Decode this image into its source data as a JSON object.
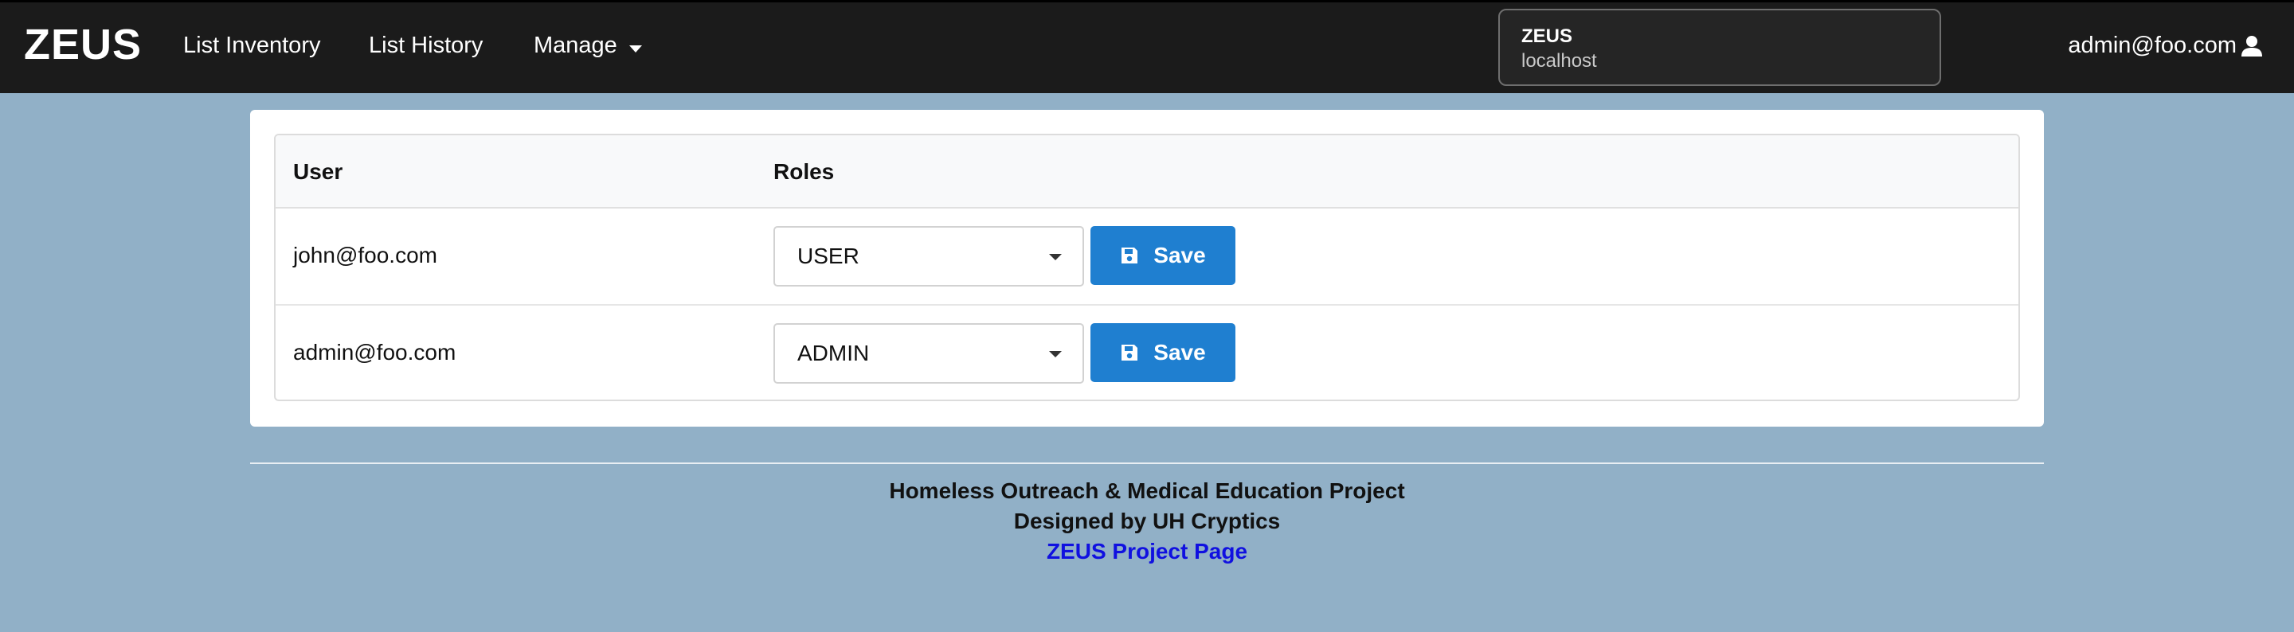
{
  "navbar": {
    "brand": "ZEUS",
    "items": [
      {
        "label": "List Inventory"
      },
      {
        "label": "List History"
      },
      {
        "label": "Manage"
      }
    ],
    "user_email": "admin@foo.com"
  },
  "popup": {
    "title": "ZEUS",
    "subtitle": "localhost"
  },
  "table": {
    "columns": [
      "User",
      "Roles"
    ],
    "rows": [
      {
        "user": "john@foo.com",
        "role": "USER",
        "save_label": "Save"
      },
      {
        "user": "admin@foo.com",
        "role": "ADMIN",
        "save_label": "Save"
      }
    ]
  },
  "footer": {
    "line1": "Homeless Outreach & Medical Education Project",
    "line2": "Designed by UH Cryptics",
    "link": "ZEUS Project Page"
  },
  "colors": {
    "background": "#91b0c7",
    "navbar": "#1b1b1b",
    "save_button": "#1f7fd0",
    "link": "#1010e0"
  },
  "icons": {
    "user_menu": "user-icon",
    "save": "floppy-disk-icon",
    "manage_dropdown": "caret-down-icon"
  }
}
